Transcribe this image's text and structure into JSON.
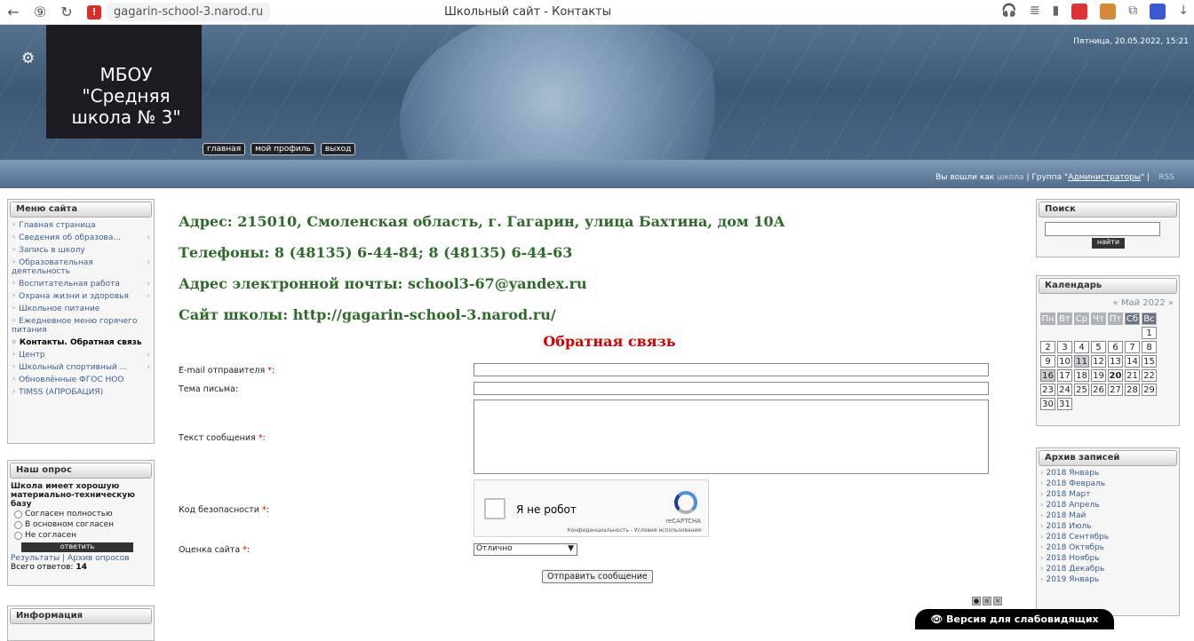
{
  "browser": {
    "url": "gagarin-school-3.narod.ru",
    "title": "Школьный сайт - Контакты"
  },
  "header": {
    "school_name": "МБОУ \"Средняя школа № 3\"",
    "date": "Пятница, 20.05.2022, 15:21",
    "nav": [
      "главная",
      "мой профиль",
      "выход"
    ],
    "logged_prefix": "Вы вошли как",
    "logged_user": "школа",
    "group_prefix": "| Группа \"",
    "group_name": "Администраторы",
    "group_suffix": "\" |",
    "rss": "RSS"
  },
  "menu": {
    "title": "Меню сайта",
    "items": [
      {
        "label": "Главная страница",
        "sub": false
      },
      {
        "label": "Сведения об образова...",
        "sub": true
      },
      {
        "label": "Запись в школу",
        "sub": false
      },
      {
        "label": "Образовательная деятельность",
        "sub": true
      },
      {
        "label": "Воспитательная работа",
        "sub": true
      },
      {
        "label": "Охрана жизни и здоровья",
        "sub": true
      },
      {
        "label": "Школьное питание",
        "sub": false
      },
      {
        "label": "Ежедневное меню горячего питания",
        "sub": false
      },
      {
        "label": "Контакты. Обратная связь",
        "sub": false,
        "active": true
      },
      {
        "label": "Центр",
        "sub": true
      },
      {
        "label": "Школьный спортивный ...",
        "sub": true
      },
      {
        "label": "Обновлённые ФГОС НОО",
        "sub": false
      },
      {
        "label": "TIMSS (АПРОБАЦИЯ)",
        "sub": false
      }
    ]
  },
  "poll": {
    "title": "Наш опрос",
    "question": "Школа имеет хорошую материально-техническую базу",
    "options": [
      "Согласен полностью",
      "В основном согласен",
      "Не согласен"
    ],
    "answer": "ответить",
    "results": "Результаты",
    "archive": "Архив опросов",
    "total_label": "Всего ответов:",
    "total": "14"
  },
  "info": {
    "title": "Информация"
  },
  "contacts": {
    "address": "Адрес: 215010, Смоленская область, г. Гагарин, улица Бахтина, дом 10А",
    "phones": "Телефоны: 8 (48135) 6-44-84; 8 (48135) 6-44-63",
    "email": "Адрес электронной почты: school3-67@yandex.ru",
    "site": "Сайт школы: http://gagarin-school-3.narod.ru/"
  },
  "form": {
    "title": "Обратная связь",
    "email_label": "E-mail отправителя",
    "subject_label": "Тема письма:",
    "text_label": "Текст сообщения",
    "code_label": "Код безопасности",
    "rating_label": "Оценка сайта",
    "rating_value": "Отлично",
    "send": "Отправить сообщение",
    "captcha_text": "Я не робот",
    "captcha_brand": "reCAPTCHA",
    "captcha_privacy": "Конфиденциальность - Условия использования"
  },
  "search": {
    "title": "Поиск",
    "button": "найти"
  },
  "calendar": {
    "title": "Календарь",
    "month": "« Май 2022 »",
    "days": [
      "Пн",
      "Вт",
      "Ср",
      "Чт",
      "Пт",
      "Сб",
      "Вс"
    ]
  },
  "archive": {
    "title": "Архив записей",
    "items": [
      "2018 Январь",
      "2018 Февраль",
      "2018 Март",
      "2018 Апрель",
      "2018 Май",
      "2018 Июль",
      "2018 Сентябрь",
      "2018 Октябрь",
      "2018 Ноябрь",
      "2018 Декабрь",
      "2019 Январь"
    ]
  },
  "vision": "👁 Версия для слабовидящих"
}
